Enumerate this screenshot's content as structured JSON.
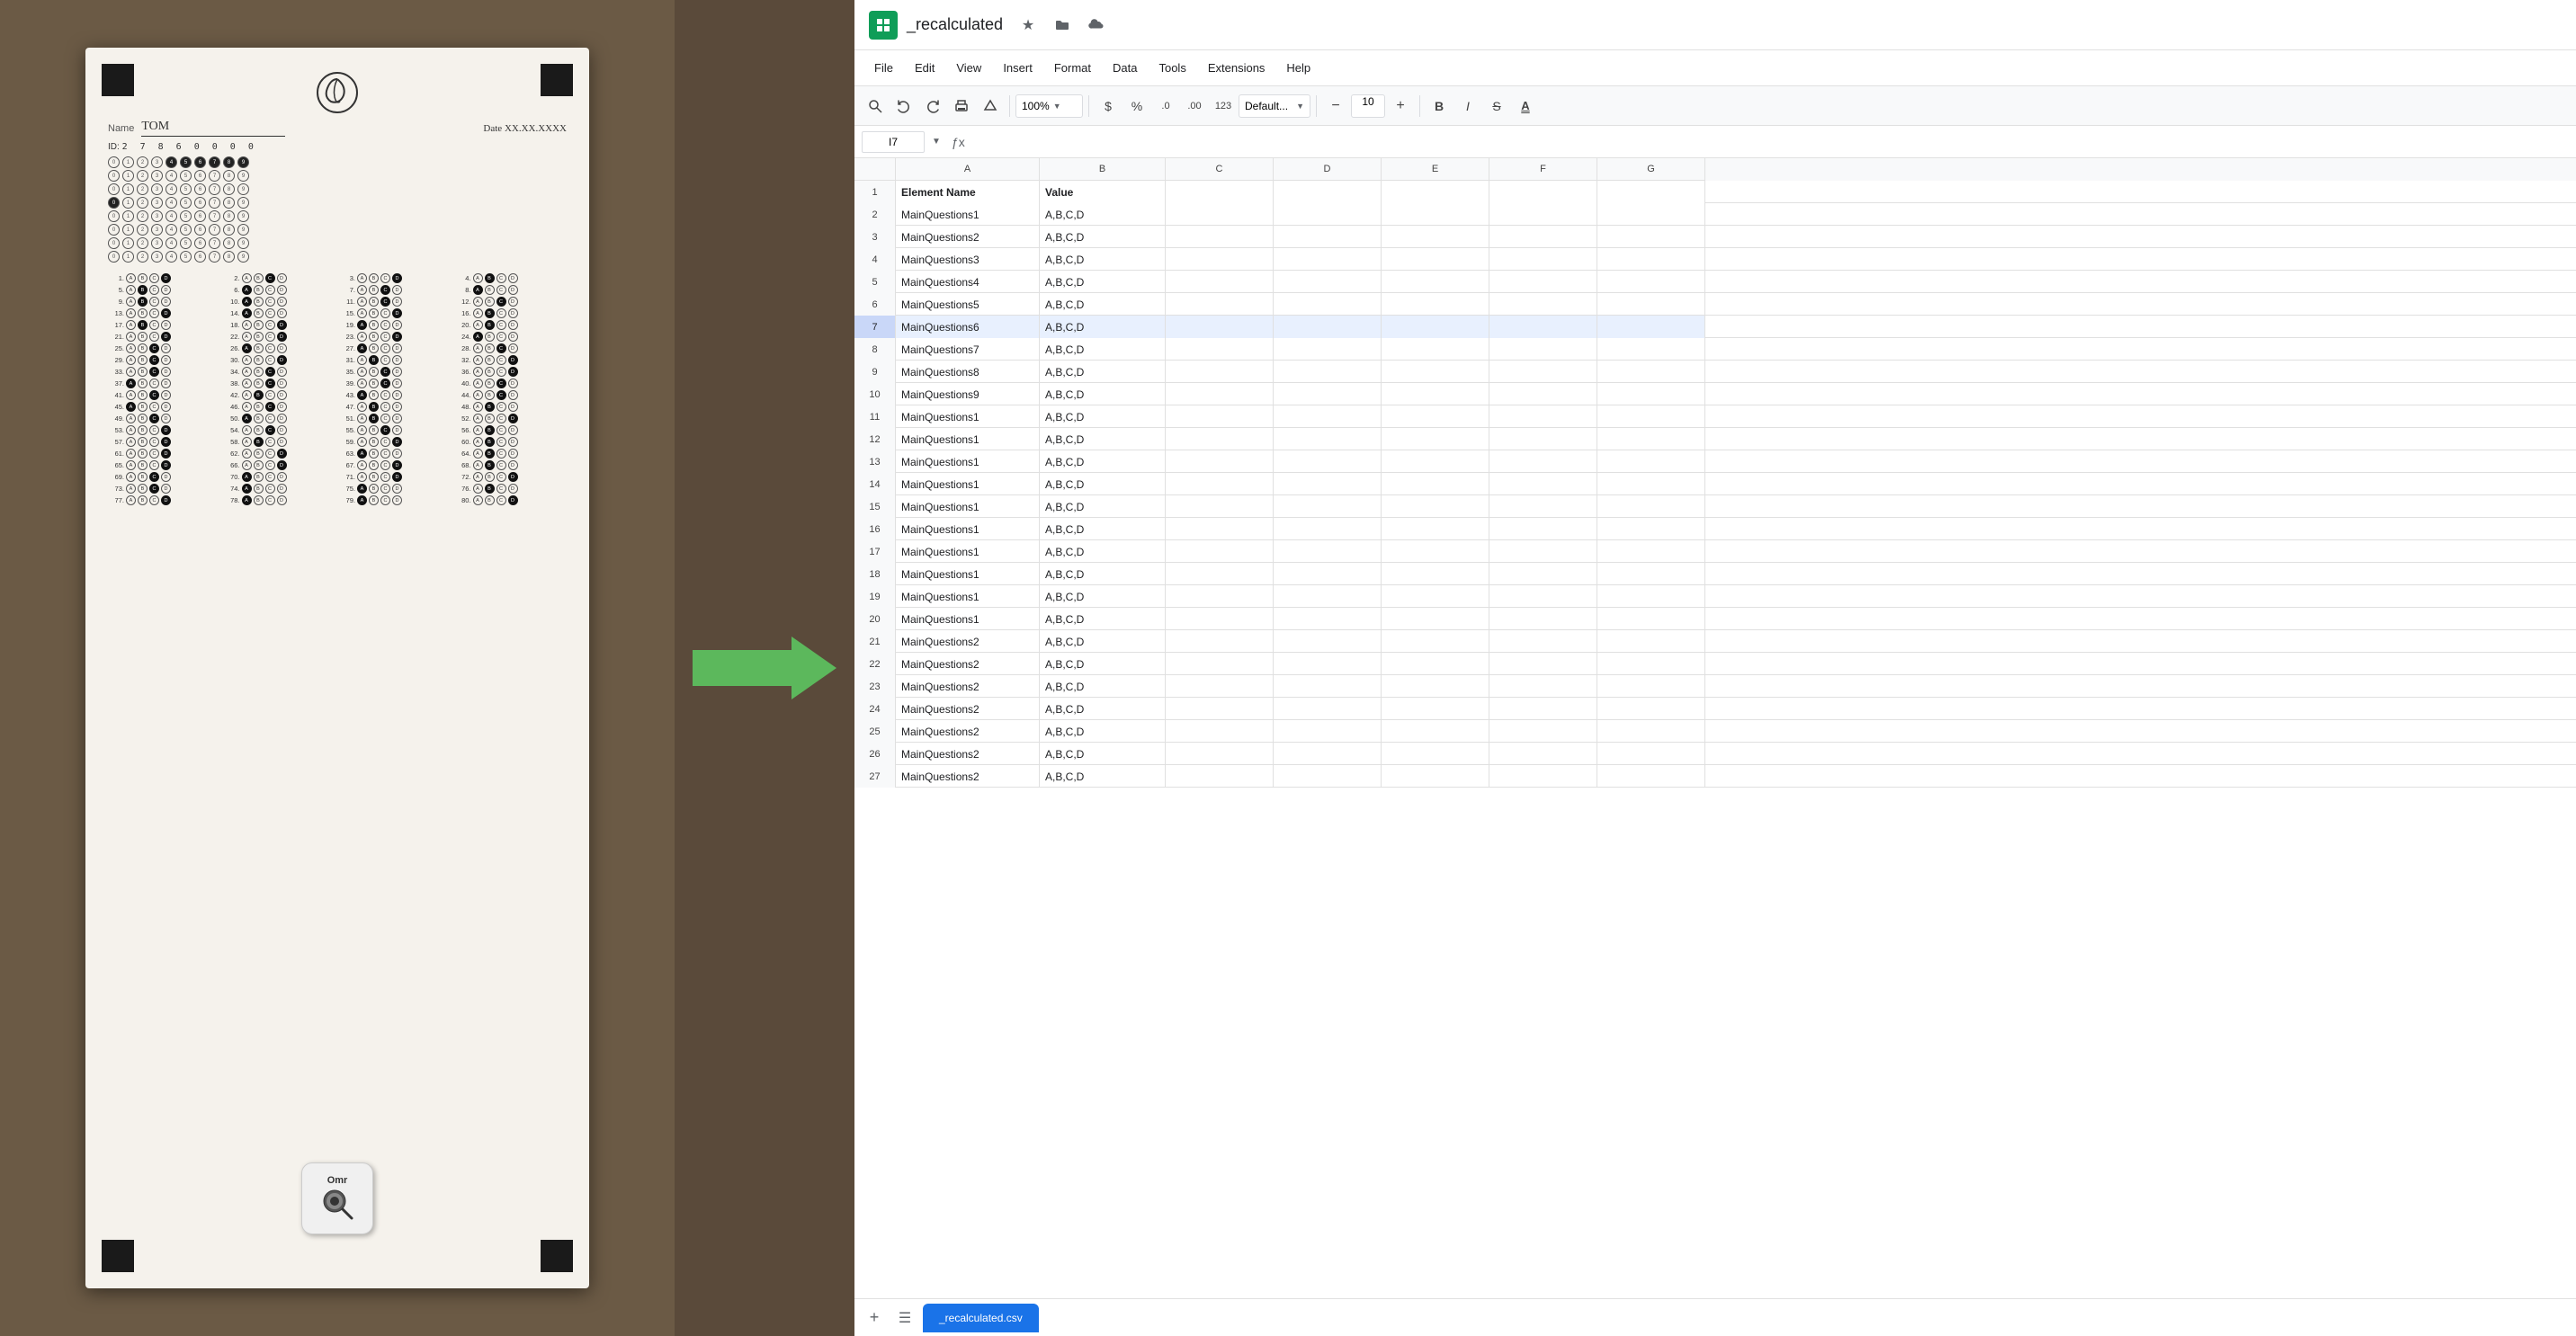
{
  "left_panel": {
    "omr_sheet": {
      "name_label": "Name",
      "name_value": "TOM",
      "date_label": "Date",
      "date_value": "XX.XX.XXXX",
      "id_label": "ID:",
      "id_digits": "2 7 8 6 0 0 0 0",
      "app_icon_label": "Omr"
    }
  },
  "arrow": {
    "label": "→"
  },
  "title_bar": {
    "doc_title": "_recalculated",
    "star_icon": "★",
    "folder_icon": "📁",
    "cloud_icon": "☁"
  },
  "menu_bar": {
    "items": [
      "File",
      "Edit",
      "View",
      "Insert",
      "Format",
      "Data",
      "Tools",
      "Extensions",
      "Help"
    ]
  },
  "toolbar": {
    "zoom_value": "100%",
    "currency_symbol": "$",
    "percent_symbol": "%",
    "decimal_format1": ".0",
    "decimal_format2": ".00",
    "number_format": "123",
    "font_name": "Default...",
    "font_size": "10",
    "bold_label": "B",
    "italic_label": "I",
    "strikethrough_label": "S"
  },
  "formula_bar": {
    "cell_ref": "I7",
    "formula_content": ""
  },
  "columns": [
    "A",
    "B",
    "C",
    "D",
    "E",
    "F",
    "G"
  ],
  "rows": [
    {
      "num": 1,
      "a": "Element Name",
      "b": "Value",
      "c": "",
      "d": "",
      "e": "",
      "f": "",
      "g": ""
    },
    {
      "num": 2,
      "a": "MainQuestions1",
      "b": "A,B,C,D",
      "c": "",
      "d": "",
      "e": "",
      "f": "",
      "g": ""
    },
    {
      "num": 3,
      "a": "MainQuestions2",
      "b": "A,B,C,D",
      "c": "",
      "d": "",
      "e": "",
      "f": "",
      "g": ""
    },
    {
      "num": 4,
      "a": "MainQuestions3",
      "b": "A,B,C,D",
      "c": "",
      "d": "",
      "e": "",
      "f": "",
      "g": ""
    },
    {
      "num": 5,
      "a": "MainQuestions4",
      "b": "A,B,C,D",
      "c": "",
      "d": "",
      "e": "",
      "f": "",
      "g": ""
    },
    {
      "num": 6,
      "a": "MainQuestions5",
      "b": "A,B,C,D",
      "c": "",
      "d": "",
      "e": "",
      "f": "",
      "g": ""
    },
    {
      "num": 7,
      "a": "MainQuestions6",
      "b": "A,B,C,D",
      "c": "",
      "d": "",
      "e": "",
      "f": "",
      "g": "",
      "selected": true
    },
    {
      "num": 8,
      "a": "MainQuestions7",
      "b": "A,B,C,D",
      "c": "",
      "d": "",
      "e": "",
      "f": "",
      "g": ""
    },
    {
      "num": 9,
      "a": "MainQuestions8",
      "b": "A,B,C,D",
      "c": "",
      "d": "",
      "e": "",
      "f": "",
      "g": ""
    },
    {
      "num": 10,
      "a": "MainQuestions9",
      "b": "A,B,C,D",
      "c": "",
      "d": "",
      "e": "",
      "f": "",
      "g": ""
    },
    {
      "num": 11,
      "a": "MainQuestions1",
      "b": "A,B,C,D",
      "c": "",
      "d": "",
      "e": "",
      "f": "",
      "g": ""
    },
    {
      "num": 12,
      "a": "MainQuestions1",
      "b": "A,B,C,D",
      "c": "",
      "d": "",
      "e": "",
      "f": "",
      "g": ""
    },
    {
      "num": 13,
      "a": "MainQuestions1",
      "b": "A,B,C,D",
      "c": "",
      "d": "",
      "e": "",
      "f": "",
      "g": ""
    },
    {
      "num": 14,
      "a": "MainQuestions1",
      "b": "A,B,C,D",
      "c": "",
      "d": "",
      "e": "",
      "f": "",
      "g": ""
    },
    {
      "num": 15,
      "a": "MainQuestions1",
      "b": "A,B,C,D",
      "c": "",
      "d": "",
      "e": "",
      "f": "",
      "g": ""
    },
    {
      "num": 16,
      "a": "MainQuestions1",
      "b": "A,B,C,D",
      "c": "",
      "d": "",
      "e": "",
      "f": "",
      "g": ""
    },
    {
      "num": 17,
      "a": "MainQuestions1",
      "b": "A,B,C,D",
      "c": "",
      "d": "",
      "e": "",
      "f": "",
      "g": ""
    },
    {
      "num": 18,
      "a": "MainQuestions1",
      "b": "A,B,C,D",
      "c": "",
      "d": "",
      "e": "",
      "f": "",
      "g": ""
    },
    {
      "num": 19,
      "a": "MainQuestions1",
      "b": "A,B,C,D",
      "c": "",
      "d": "",
      "e": "",
      "f": "",
      "g": ""
    },
    {
      "num": 20,
      "a": "MainQuestions1",
      "b": "A,B,C,D",
      "c": "",
      "d": "",
      "e": "",
      "f": "",
      "g": ""
    },
    {
      "num": 21,
      "a": "MainQuestions2",
      "b": "A,B,C,D",
      "c": "",
      "d": "",
      "e": "",
      "f": "",
      "g": ""
    },
    {
      "num": 22,
      "a": "MainQuestions2",
      "b": "A,B,C,D",
      "c": "",
      "d": "",
      "e": "",
      "f": "",
      "g": ""
    },
    {
      "num": 23,
      "a": "MainQuestions2",
      "b": "A,B,C,D",
      "c": "",
      "d": "",
      "e": "",
      "f": "",
      "g": ""
    },
    {
      "num": 24,
      "a": "MainQuestions2",
      "b": "A,B,C,D",
      "c": "",
      "d": "",
      "e": "",
      "f": "",
      "g": ""
    },
    {
      "num": 25,
      "a": "MainQuestions2",
      "b": "A,B,C,D",
      "c": "",
      "d": "",
      "e": "",
      "f": "",
      "g": ""
    },
    {
      "num": 26,
      "a": "MainQuestions2",
      "b": "A,B,C,D",
      "c": "",
      "d": "",
      "e": "",
      "f": "",
      "g": ""
    },
    {
      "num": 27,
      "a": "MainQuestions2",
      "b": "A,B,C,D",
      "c": "",
      "d": "",
      "e": "",
      "f": "",
      "g": ""
    }
  ],
  "bottom_bar": {
    "sheet_tab_label": "_recalculated.csv"
  },
  "colors": {
    "sheets_green": "#0f9d58",
    "selected_blue": "#1a73e8",
    "selected_row_bg": "#e8f0fe",
    "header_bg": "#f8f9fa",
    "border": "#e0e0e0"
  }
}
